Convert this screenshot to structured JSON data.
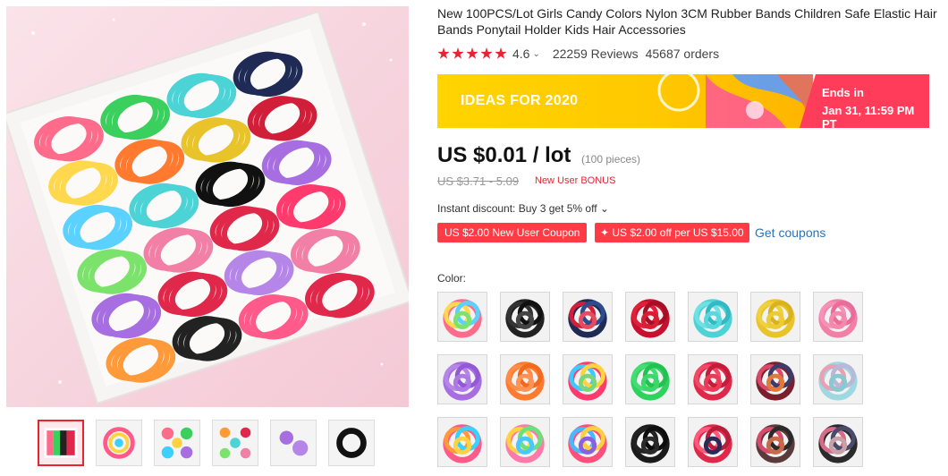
{
  "product": {
    "title": "New 100PCS/Lot Girls Candy Colors Nylon 3CM Rubber Bands Children Safe Elastic Hair Bands Ponytail Holder Kids Hair Accessories",
    "rating": "4.6",
    "rating_chevron": "⌄",
    "reviews": "22259 Reviews",
    "orders": "45687 orders",
    "star_count": 5
  },
  "banner": {
    "promo_text": "IDEAS FOR 2020",
    "ends_label": "Ends in",
    "ends_date": "Jan 31, 11:59 PM PT"
  },
  "pricing": {
    "price": "US $0.01 / lot",
    "pieces": "(100 pieces)",
    "old_price": "US $3.71 - 5.09",
    "bonus": "New User BONUS",
    "instant_discount": "Instant discount: Buy 3 get 5% off ⌄",
    "coupon1": "US $2.00 New User Coupon",
    "coupon2": "✦ US $2.00 off per US $15.00",
    "get_coupons": "Get coupons"
  },
  "color_section": {
    "label": "Color:"
  },
  "colors": {
    "accent": "#e8242f",
    "banner_yellow": "#ffc800",
    "banner_pink": "#ff3c5a",
    "link_blue": "#2a74b6"
  },
  "gallery": {
    "thumbnails": [
      "multi-color box",
      "bundle",
      "flower clusters",
      "pastel clusters",
      "purple bands",
      "black bands"
    ],
    "active_thumbnail": 0
  },
  "swatches": [
    [
      "#ff6b8a",
      "#ffd84d",
      "#5ad1ff",
      "#7be36b"
    ],
    [
      "#222222",
      "#333333",
      "#111111",
      "#444444"
    ],
    [
      "#1f2a55",
      "#d11f3a",
      "#2b4c8f",
      "#e84a5f"
    ],
    [
      "#c8102e",
      "#e0203a",
      "#a80f25",
      "#d81e35"
    ],
    [
      "#4cd3d6",
      "#6fe0e3",
      "#33b9c6",
      "#58d8dc"
    ],
    [
      "#e8c42a",
      "#f0d040",
      "#d9b21d",
      "#eccb36"
    ],
    [
      "#f27fa6",
      "#f592b5",
      "#e86d98",
      "#f488ad"
    ],
    [
      "#a66ee0",
      "#b585e8",
      "#9558d4",
      "#ad7ae3"
    ],
    [
      "#ff7a2f",
      "#ff8c47",
      "#f26a1e",
      "#ff9355"
    ],
    [
      "#ff3b6d",
      "#3fc8ff",
      "#ffd23f",
      "#7bd67a"
    ],
    [
      "#2ed35f",
      "#45dd73",
      "#22c252",
      "#3ad86a"
    ],
    [
      "#e0284a",
      "#f04a66",
      "#c41c3a",
      "#ea3a58"
    ],
    [
      "#7b1f2a",
      "#d84a6a",
      "#3c3c6a",
      "#e07a3a"
    ],
    [
      "#9fd8e0",
      "#e8a0b4",
      "#b8b8d8",
      "#88c8d0"
    ],
    [
      "#ff5a8a",
      "#ff9a3a",
      "#3ad0ff",
      "#ffd23f"
    ],
    [
      "#ff7aa8",
      "#ffd23f",
      "#6ce07a",
      "#48c8ff"
    ],
    [
      "#ff4f7a",
      "#49b8ff",
      "#ffcf3f",
      "#8a60e0"
    ],
    [
      "#1a1a1a",
      "#222222",
      "#0d0d0d",
      "#2a2a2a"
    ],
    [
      "#e0284a",
      "#ff5a7a",
      "#b81d3a",
      "#2a2a5a"
    ],
    [
      "#5a3a3a",
      "#d84a6a",
      "#2a2a2a",
      "#c86a4a"
    ],
    [
      "#2a2a2a",
      "#d86a8a",
      "#4a4a6a",
      "#c8a0a8"
    ]
  ]
}
